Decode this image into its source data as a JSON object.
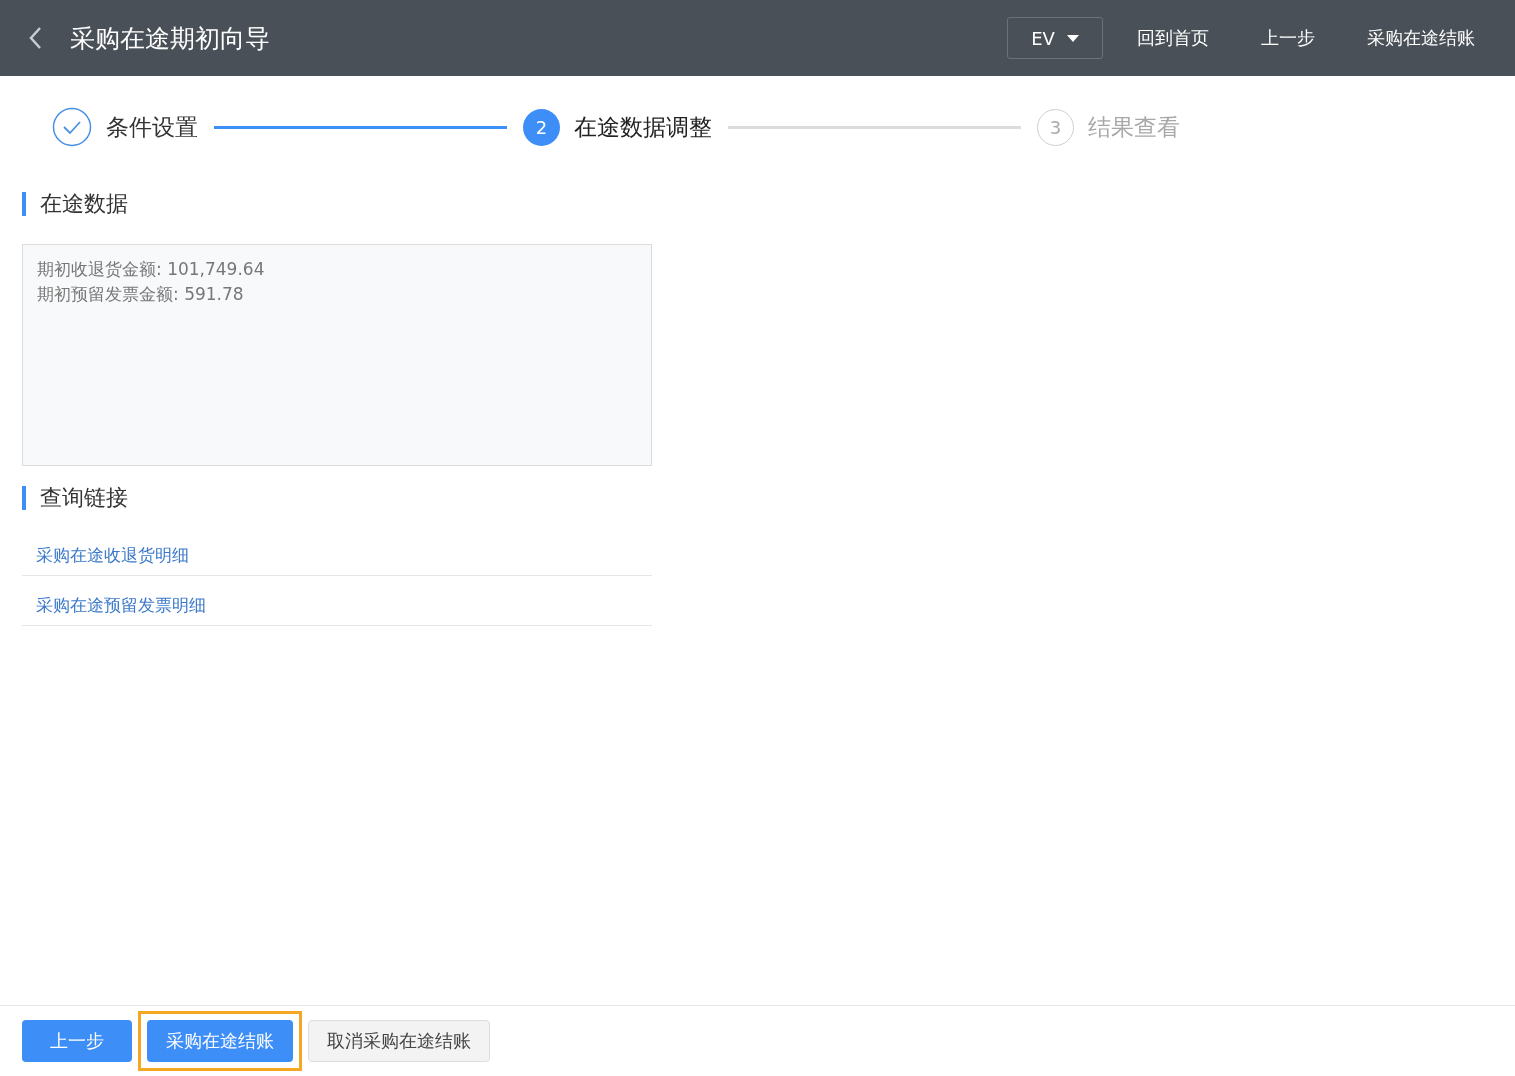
{
  "header": {
    "title": "采购在途期初向导",
    "org_select": {
      "value": "EV"
    },
    "actions": [
      "回到首页",
      "上一步",
      "采购在途结账"
    ]
  },
  "steps": [
    {
      "completed": true,
      "active": false,
      "label": "条件设置"
    },
    {
      "completed": false,
      "active": true,
      "number": "2",
      "label": "在途数据调整"
    },
    {
      "completed": false,
      "active": false,
      "number": "3",
      "label": "结果查看"
    }
  ],
  "data_section": {
    "title": "在途数据",
    "lines": [
      "期初收退货金额: 101,749.64",
      "期初预留发票金额: 591.78"
    ]
  },
  "links_section": {
    "title": "查询链接",
    "links": [
      "采购在途收退货明细",
      "采购在途预留发票明细"
    ]
  },
  "footer_buttons": [
    {
      "label": "上一步",
      "kind": "primary",
      "highlighted": false
    },
    {
      "label": "采购在途结账",
      "kind": "primary",
      "highlighted": true
    },
    {
      "label": "取消采购在途结账",
      "kind": "default",
      "highlighted": false
    }
  ]
}
